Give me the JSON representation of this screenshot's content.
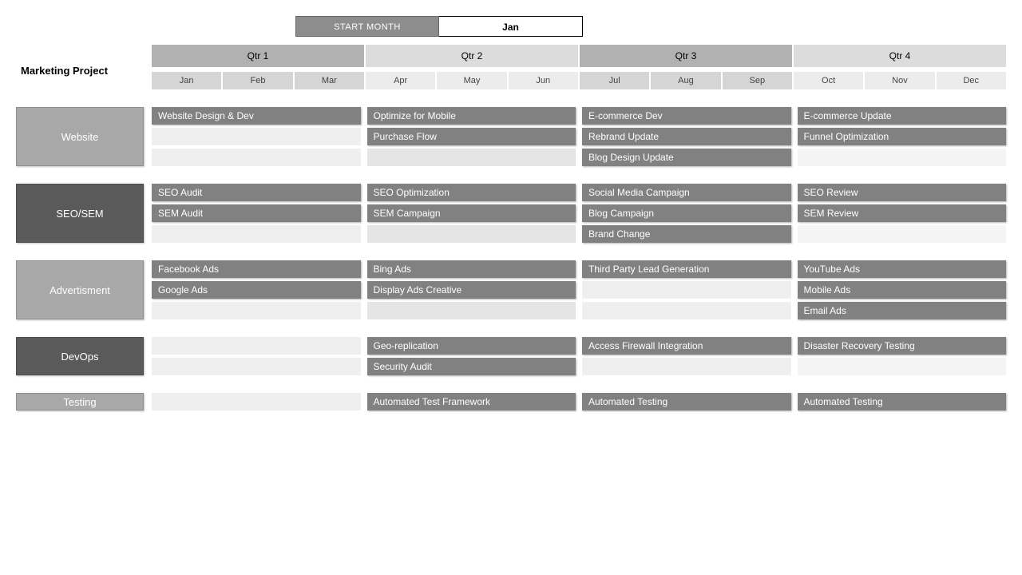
{
  "start_month_label": "START MONTH",
  "start_month_value": "Jan",
  "title": "Marketing Project",
  "quarters": [
    "Qtr 1",
    "Qtr 2",
    "Qtr 3",
    "Qtr 4"
  ],
  "months": [
    "Jan",
    "Feb",
    "Mar",
    "Apr",
    "May",
    "Jun",
    "Jul",
    "Aug",
    "Sep",
    "Oct",
    "Nov",
    "Dec"
  ],
  "sections": [
    {
      "name": "Website",
      "shade": "light",
      "rows": [
        {
          "q1": "Website Design & Dev",
          "q2": "Optimize for Mobile",
          "q3": "E-commerce Dev",
          "q4": "E-commerce Update"
        },
        {
          "q1": "",
          "q2": "Purchase Flow",
          "q3": "Rebrand Update",
          "q4": "Funnel Optimization"
        },
        {
          "q1": "",
          "q2": "",
          "q3": "Blog Design Update",
          "q4": ""
        }
      ]
    },
    {
      "name": "SEO/SEM",
      "shade": "dark",
      "rows": [
        {
          "q1": "SEO Audit",
          "q2": "SEO Optimization",
          "q3": "Social Media Campaign",
          "q4": "SEO Review"
        },
        {
          "q1": "SEM Audit",
          "q2": "SEM Campaign",
          "q3": "Blog Campaign",
          "q4": "SEM Review"
        },
        {
          "q1": "",
          "q2": "",
          "q3": "Brand Change",
          "q4": ""
        }
      ]
    },
    {
      "name": "Advertisment",
      "shade": "light",
      "rows": [
        {
          "q1": "Facebook Ads",
          "q2": "Bing Ads",
          "q3": "Third Party Lead Generation",
          "q4": "YouTube Ads"
        },
        {
          "q1": "Google Ads",
          "q2": "Display Ads Creative",
          "q3": "",
          "q4": "Mobile Ads"
        },
        {
          "q1": "",
          "q2": "",
          "q3": "",
          "q4": "Email Ads"
        }
      ]
    },
    {
      "name": "DevOps",
      "shade": "dark",
      "rows": [
        {
          "q1": "",
          "q2": "Geo-replication",
          "q3": "Access Firewall Integration",
          "q4": "Disaster Recovery Testing"
        },
        {
          "q1": "",
          "q2": "Security Audit",
          "q3": "",
          "q4": ""
        }
      ]
    },
    {
      "name": "Testing",
      "shade": "light",
      "rows": [
        {
          "q1": "",
          "q2": "Automated Test Framework",
          "q3": "Automated Testing",
          "q4": "Automated Testing"
        }
      ]
    }
  ]
}
